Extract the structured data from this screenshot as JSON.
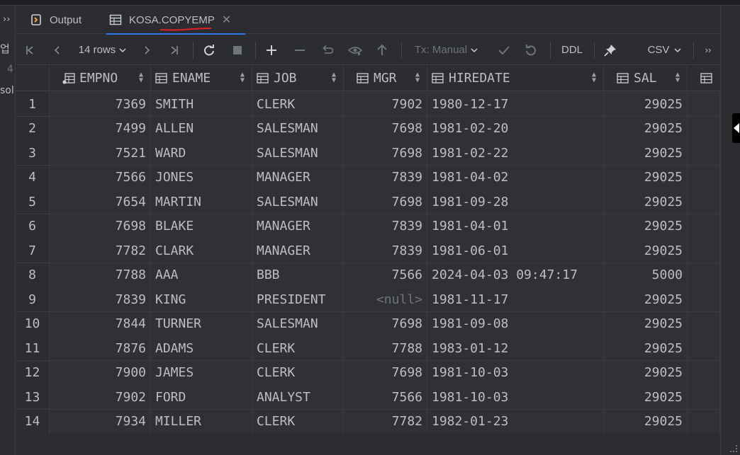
{
  "left_gutter": {
    "chevron": "››",
    "frag1": "업",
    "frag2": "4",
    "frag3": "sol"
  },
  "tabs": [
    {
      "label": "Output",
      "icon": "output-icon",
      "active": false
    },
    {
      "label": "KOSA.COPYEMP",
      "icon": "table-icon",
      "active": true
    }
  ],
  "toolbar": {
    "rows_label": "14 rows",
    "tx_label": "Tx: Manual",
    "ddl_label": "DDL",
    "csv_label": "CSV",
    "more": "››"
  },
  "columns": [
    "EMPNO",
    "ENAME",
    "JOB",
    "MGR",
    "HIREDATE",
    "SAL"
  ],
  "rows": [
    {
      "n": "1",
      "empno": "7369",
      "ename": "SMITH",
      "job": "CLERK",
      "mgr": "7902",
      "hiredate": "1980-12-17",
      "sal": "29025"
    },
    {
      "n": "2",
      "empno": "7499",
      "ename": "ALLEN",
      "job": "SALESMAN",
      "mgr": "7698",
      "hiredate": "1981-02-20",
      "sal": "29025"
    },
    {
      "n": "3",
      "empno": "7521",
      "ename": "WARD",
      "job": "SALESMAN",
      "mgr": "7698",
      "hiredate": "1981-02-22",
      "sal": "29025"
    },
    {
      "n": "4",
      "empno": "7566",
      "ename": "JONES",
      "job": "MANAGER",
      "mgr": "7839",
      "hiredate": "1981-04-02",
      "sal": "29025"
    },
    {
      "n": "5",
      "empno": "7654",
      "ename": "MARTIN",
      "job": "SALESMAN",
      "mgr": "7698",
      "hiredate": "1981-09-28",
      "sal": "29025"
    },
    {
      "n": "6",
      "empno": "7698",
      "ename": "BLAKE",
      "job": "MANAGER",
      "mgr": "7839",
      "hiredate": "1981-04-01",
      "sal": "29025"
    },
    {
      "n": "7",
      "empno": "7782",
      "ename": "CLARK",
      "job": "MANAGER",
      "mgr": "7839",
      "hiredate": "1981-06-01",
      "sal": "29025"
    },
    {
      "n": "8",
      "empno": "7788",
      "ename": "AAA",
      "job": "BBB",
      "mgr": "7566",
      "hiredate": "2024-04-03 09:47:17",
      "sal": "5000"
    },
    {
      "n": "9",
      "empno": "7839",
      "ename": "KING",
      "job": "PRESIDENT",
      "mgr": "<null>",
      "hiredate": "1981-11-17",
      "sal": "29025"
    },
    {
      "n": "10",
      "empno": "7844",
      "ename": "TURNER",
      "job": "SALESMAN",
      "mgr": "7698",
      "hiredate": "1981-09-08",
      "sal": "29025"
    },
    {
      "n": "11",
      "empno": "7876",
      "ename": "ADAMS",
      "job": "CLERK",
      "mgr": "7788",
      "hiredate": "1983-01-12",
      "sal": "29025"
    },
    {
      "n": "12",
      "empno": "7900",
      "ename": "JAMES",
      "job": "CLERK",
      "mgr": "7698",
      "hiredate": "1981-10-03",
      "sal": "29025"
    },
    {
      "n": "13",
      "empno": "7902",
      "ename": "FORD",
      "job": "ANALYST",
      "mgr": "7566",
      "hiredate": "1981-10-03",
      "sal": "29025"
    },
    {
      "n": "14",
      "empno": "7934",
      "ename": "MILLER",
      "job": "CLERK",
      "mgr": "7782",
      "hiredate": "1982-01-23",
      "sal": "29025"
    }
  ],
  "colors": {
    "accent": "#3574f0",
    "annotation": "#e0202a",
    "null_text": "#6f737a"
  }
}
